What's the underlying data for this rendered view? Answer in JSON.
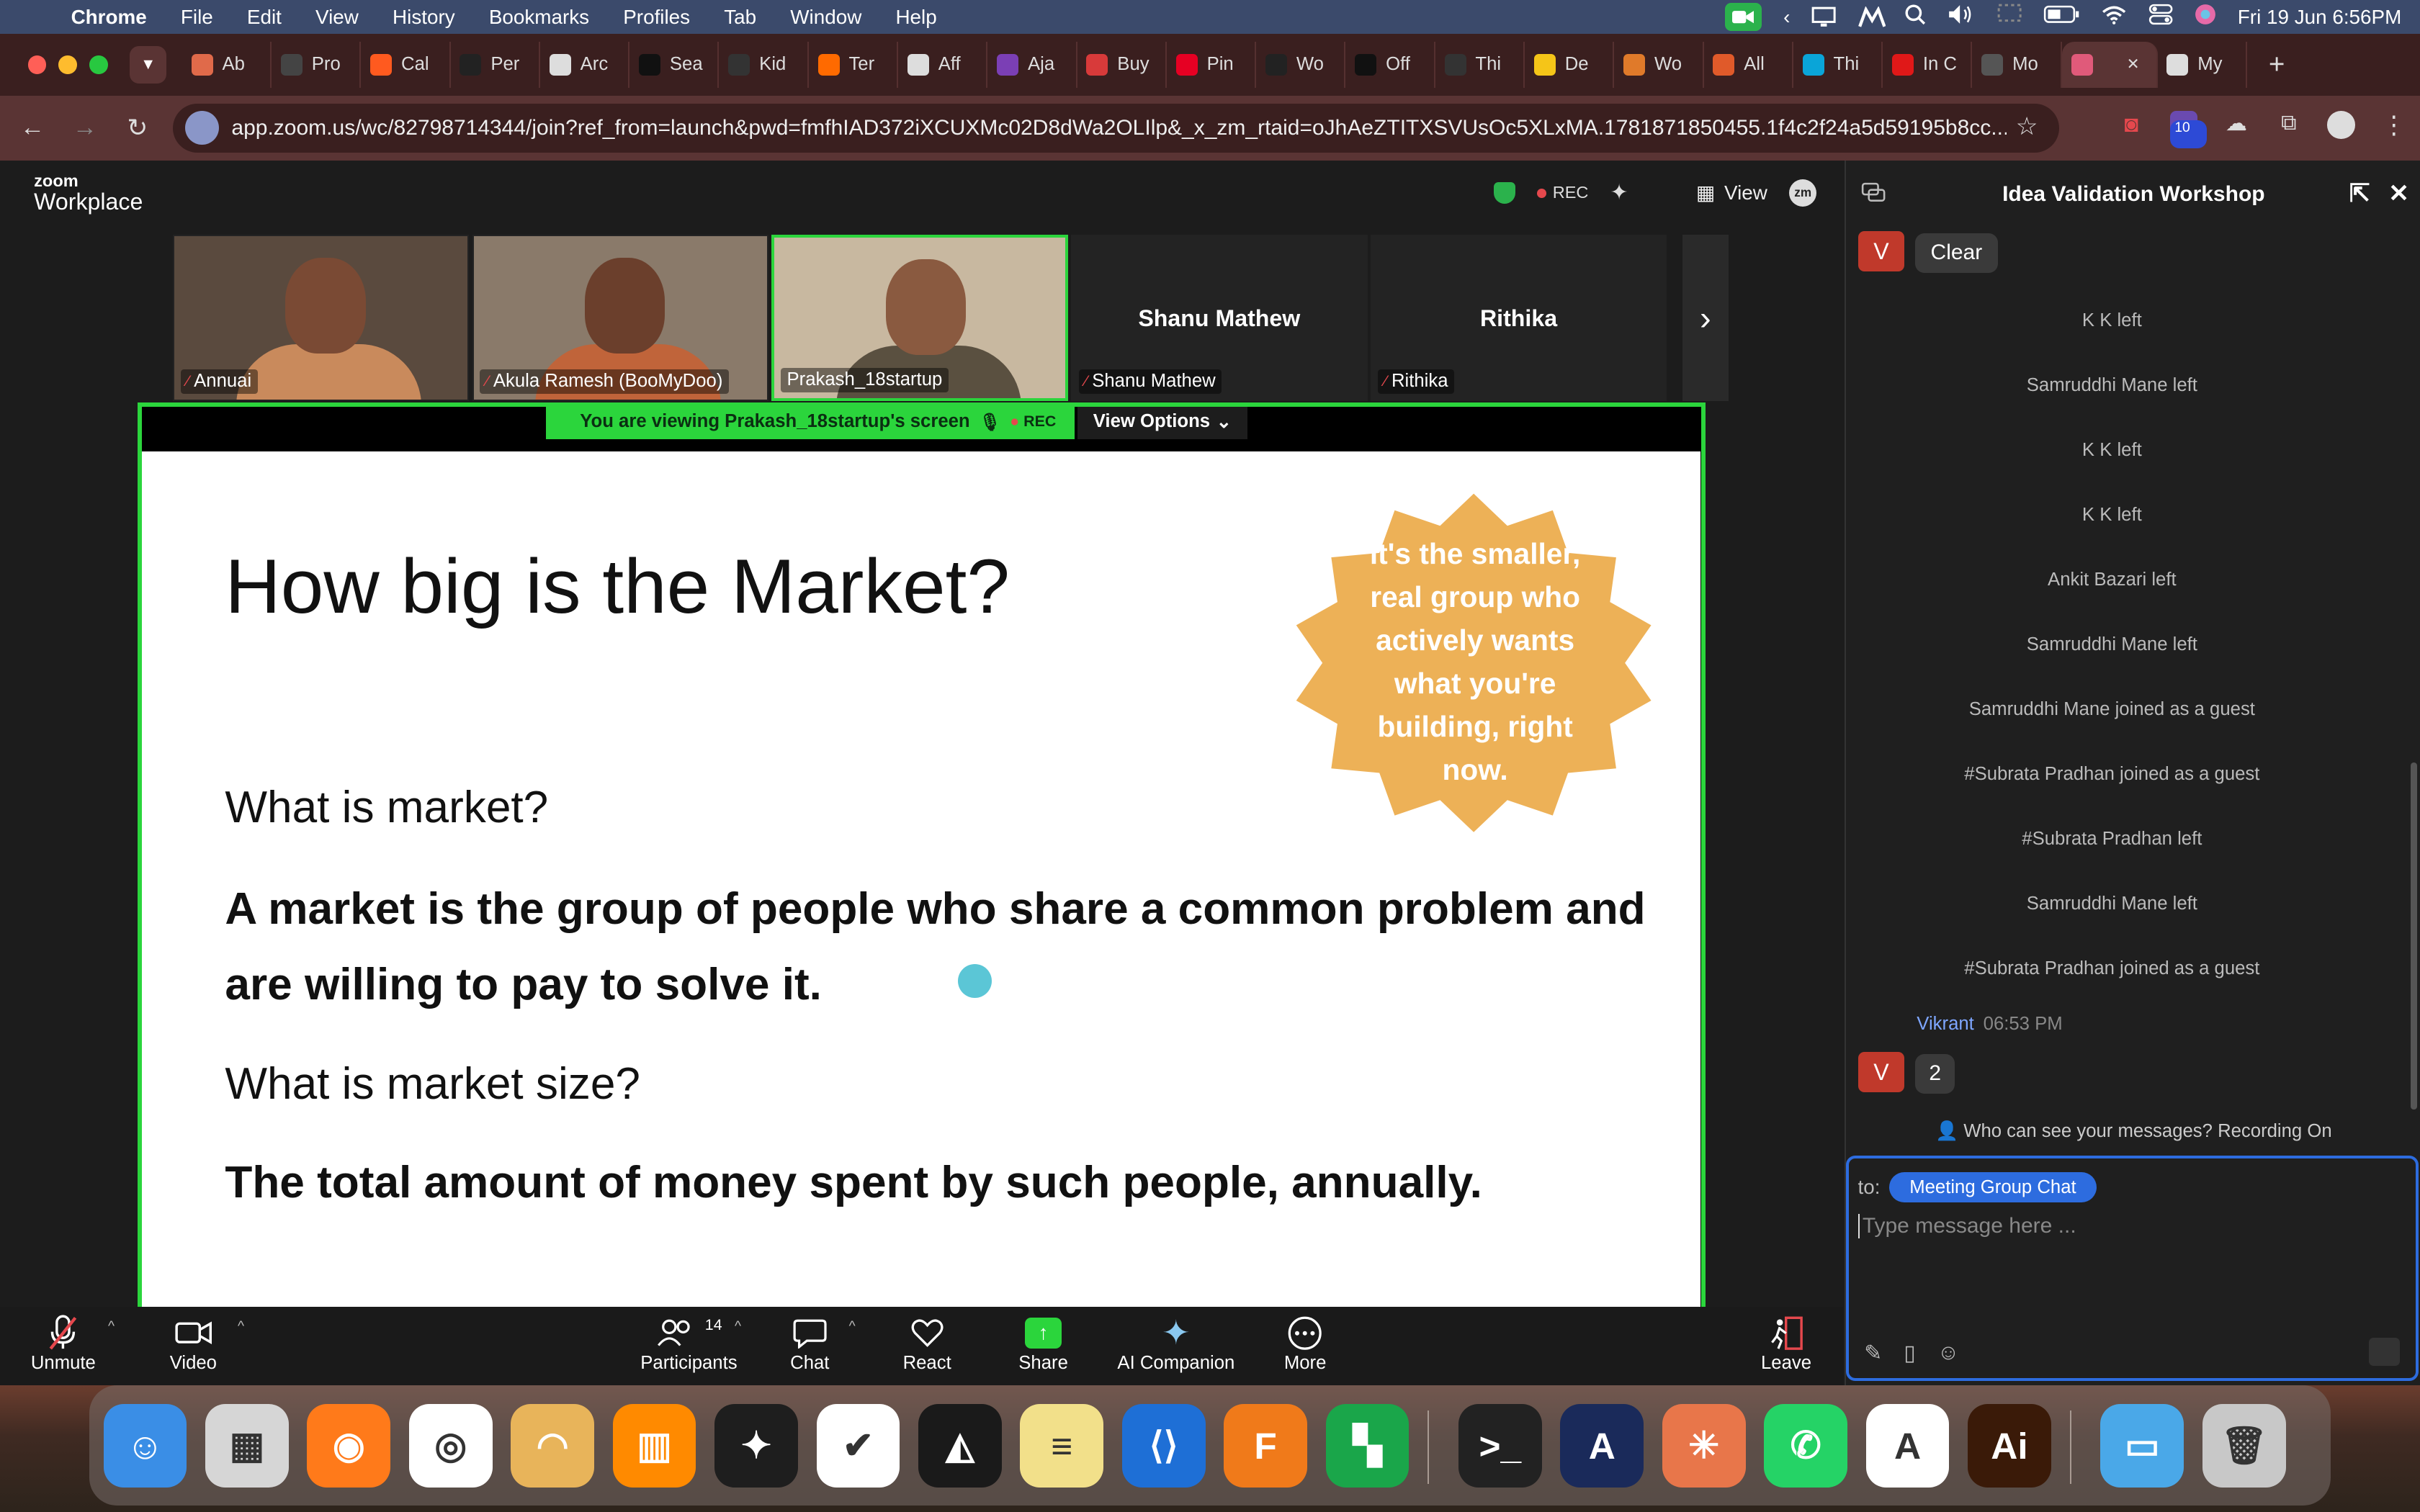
{
  "menubar": {
    "app": "Chrome",
    "items": [
      "File",
      "Edit",
      "View",
      "History",
      "Bookmarks",
      "Profiles",
      "Tab",
      "Window",
      "Help"
    ],
    "clock": "Fri 19 Jun  6:56PM"
  },
  "tabs": [
    {
      "label": "Ab",
      "color": "#e06a4a"
    },
    {
      "label": "Pro",
      "color": "#444444"
    },
    {
      "label": "Cal",
      "color": "#ff5a1f"
    },
    {
      "label": "Per",
      "color": "#222222"
    },
    {
      "label": "Arc",
      "color": "#dddddd"
    },
    {
      "label": "Sea",
      "color": "#111111"
    },
    {
      "label": "Kid",
      "color": "#333333"
    },
    {
      "label": "Ter",
      "color": "#ff6a00"
    },
    {
      "label": "Aff",
      "color": "#dddddd"
    },
    {
      "label": "Aja",
      "color": "#7b3fb5"
    },
    {
      "label": "Buy",
      "color": "#d83a3a"
    },
    {
      "label": "Pin",
      "color": "#e60023"
    },
    {
      "label": "Wo",
      "color": "#222222"
    },
    {
      "label": "Off",
      "color": "#111111"
    },
    {
      "label": "Thi",
      "color": "#333333"
    },
    {
      "label": "De",
      "color": "#f5c518"
    },
    {
      "label": "Wo",
      "color": "#e07a2a"
    },
    {
      "label": "All",
      "color": "#e05a2a"
    },
    {
      "label": "Thi",
      "color": "#0aa5d8"
    },
    {
      "label": "In C",
      "color": "#e01818"
    },
    {
      "label": "Mo",
      "color": "#555555"
    },
    {
      "label": "",
      "color": "#e05a7a",
      "active": true
    },
    {
      "label": "My",
      "color": "#dddddd"
    }
  ],
  "url": "app.zoom.us/wc/82798714344/join?ref_from=launch&pwd=fmfhIAD372iXCUXMc02D8dWa2OLIlp&_x_zm_rtaid=oJhAeZTITXSVUsOc5XLxMA.1781871850455.1f4c2f24a5d59195b8cc...",
  "extension_badge": "10",
  "zoom": {
    "logo_top": "zoom",
    "logo_bottom": "Workplace",
    "rec": "REC",
    "view": "View",
    "zm": "zm"
  },
  "participants": [
    {
      "name": "Annuai",
      "video": true,
      "skin": "#7a4a34",
      "shirt": "#c98a5c",
      "bg": "#5a4a3e",
      "muted": true
    },
    {
      "name": "Akula Ramesh (BooMyDoo)",
      "video": true,
      "skin": "#6b3f2c",
      "shirt": "#c0643a",
      "bg": "#8a7a6a",
      "muted": true
    },
    {
      "name": "Prakash_18startup",
      "video": true,
      "skin": "#8a5a40",
      "shirt": "#5a5040",
      "bg": "#c8b8a0",
      "muted": false,
      "active": true
    },
    {
      "name": "Shanu Mathew",
      "video": false,
      "muted": true
    },
    {
      "name": "Rithika",
      "video": false,
      "muted": true
    }
  ],
  "banner": {
    "viewing": "You are viewing  Prakash_18startup's screen",
    "rec": "REC",
    "view_options": "View Options"
  },
  "slide": {
    "title": "How big is the Market?",
    "badge_lines": [
      "it's the smaller,",
      "real group who",
      "actively wants",
      "what you're",
      "building, right",
      "now."
    ],
    "badge_color": "#edb157",
    "q1": "What is market?",
    "a1": "A market is the group of people who share a common problem and are willing to pay to solve it.",
    "q2": "What is market size?",
    "a2": "The total amount of money spent by such people, annually."
  },
  "controls": {
    "unmute": "Unmute",
    "video": "Video",
    "participants": "Participants",
    "participant_count": "14",
    "chat": "Chat",
    "react": "React",
    "share": "Share",
    "ai_companion": "AI Companion",
    "more": "More",
    "leave": "Leave"
  },
  "chat": {
    "title": "Idea Validation Workshop",
    "first_avatar": "V",
    "first_message": "Clear",
    "system_messages": [
      "K K left",
      "Samruddhi Mane left",
      "K K left",
      "K K left",
      "Ankit Bazari left",
      "Samruddhi Mane left",
      "Samruddhi Mane joined as a guest",
      "#Subrata Pradhan joined as a guest",
      "#Subrata Pradhan left",
      "Samruddhi Mane left",
      "#Subrata Pradhan joined as a guest"
    ],
    "sender": "Vikrant",
    "sender_time": "06:53 PM",
    "last_avatar": "V",
    "last_message": "2",
    "who_can_see": "Who can see your messages? Recording On",
    "to_label": "to:",
    "to_target": "Meeting Group Chat",
    "placeholder": "Type message here ..."
  },
  "dock": [
    {
      "name": "finder",
      "color": "#3a8ee6",
      "glyph": "☺"
    },
    {
      "name": "launchpad",
      "color": "#d6d6d6",
      "glyph": "▦"
    },
    {
      "name": "firefox",
      "color": "#ff7a1a",
      "glyph": "◉"
    },
    {
      "name": "chrome",
      "color": "#ffffff",
      "glyph": "◎"
    },
    {
      "name": "arc",
      "color": "#e8b45a",
      "glyph": "◠"
    },
    {
      "name": "books",
      "color": "#ff8a00",
      "glyph": "▥"
    },
    {
      "name": "figma",
      "color": "#1e1e1e",
      "glyph": "✦"
    },
    {
      "name": "tasks",
      "color": "#ffffff",
      "glyph": "✔"
    },
    {
      "name": "perplexity",
      "color": "#1a1a1a",
      "glyph": "◭"
    },
    {
      "name": "stickies",
      "color": "#f2e08a",
      "glyph": "≡"
    },
    {
      "name": "vscode",
      "color": "#1e6fd6",
      "glyph": "⟨⟩"
    },
    {
      "name": "fusion",
      "color": "#f07a1a",
      "glyph": "F"
    },
    {
      "name": "sheets",
      "color": "#1aa64a",
      "glyph": "▚"
    },
    {
      "name": "terminal",
      "color": "#222222",
      "glyph": ">_"
    },
    {
      "name": "affinity",
      "color": "#1a2a5a",
      "glyph": "A"
    },
    {
      "name": "claude",
      "color": "#e8764a",
      "glyph": "✳"
    },
    {
      "name": "whatsapp",
      "color": "#25d366",
      "glyph": "✆"
    },
    {
      "name": "appstore",
      "color": "#ffffff",
      "glyph": "A"
    },
    {
      "name": "illustrator",
      "color": "#3a1a08",
      "glyph": "Ai"
    },
    {
      "name": "folder",
      "color": "#4aa8e8",
      "glyph": "▭"
    },
    {
      "name": "trash",
      "color": "#c8c8c8",
      "glyph": "🗑"
    }
  ]
}
